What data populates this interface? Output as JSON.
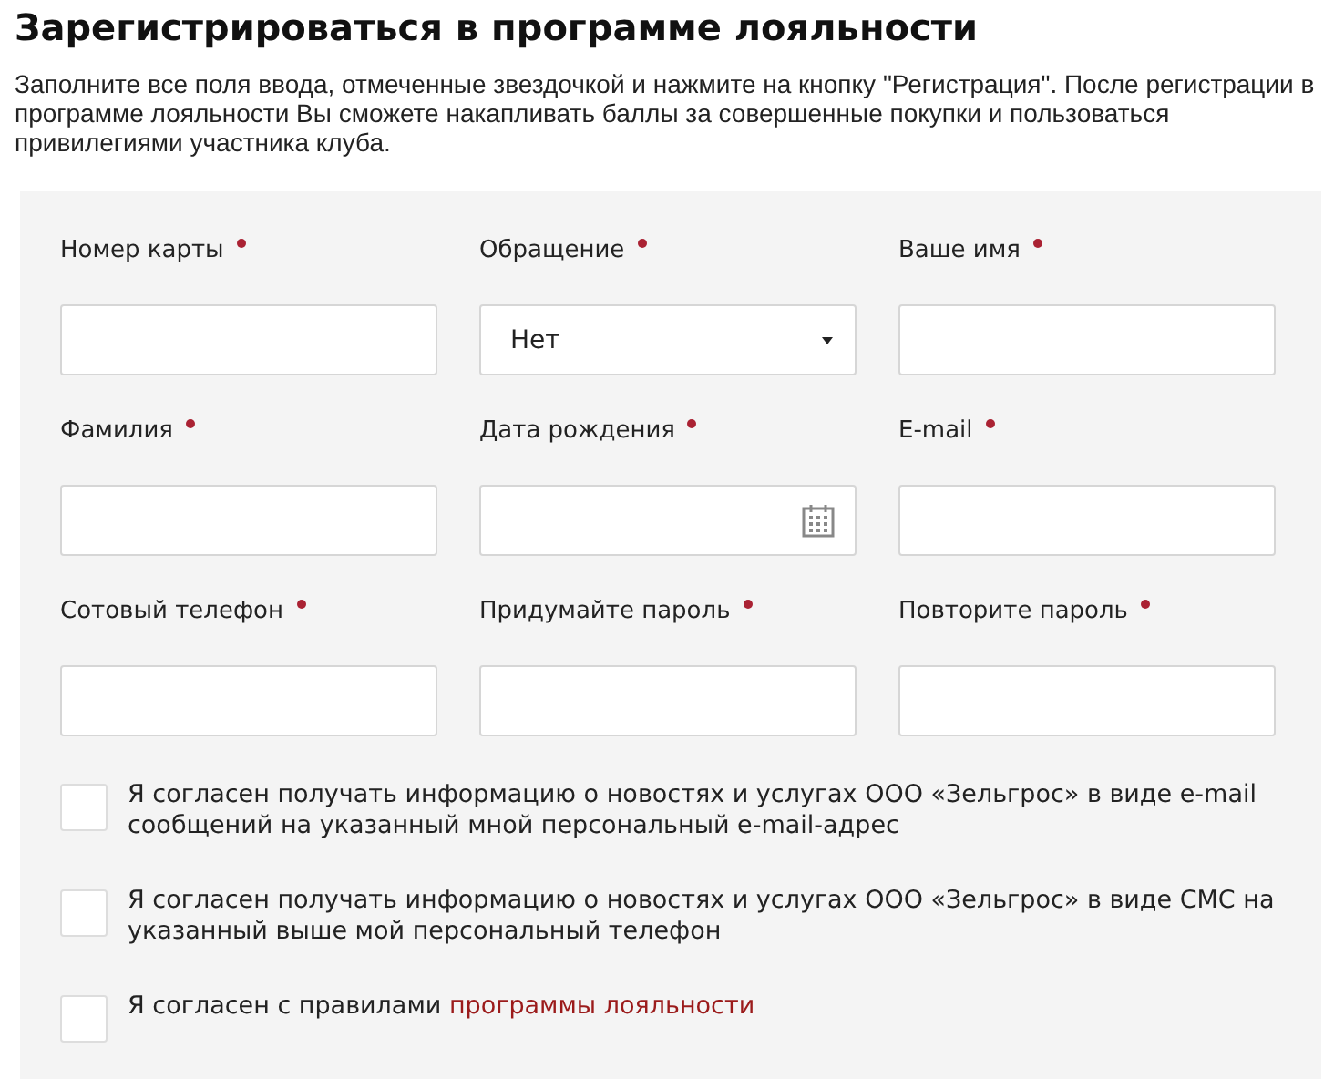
{
  "title": "Зарегистрироваться в программе лояльности",
  "intro": "Заполните все поля ввода, отмеченные звездочкой и нажмите на кнопку \"Регистрация\". После регистрации в программе лояльности Вы сможете накапливать баллы за совершенные покупки и пользоваться привилегиями участника клуба.",
  "fields": [
    {
      "label": "Номер карты",
      "required": true,
      "kind": "text"
    },
    {
      "label": "Обращение",
      "required": true,
      "kind": "select",
      "value": "Нет"
    },
    {
      "label": "Ваше имя",
      "required": true,
      "kind": "text"
    },
    {
      "label": "Фамилия",
      "required": true,
      "kind": "text"
    },
    {
      "label": "Дата рождения",
      "required": true,
      "kind": "date"
    },
    {
      "label": "E-mail",
      "required": true,
      "kind": "text"
    },
    {
      "label": "Сотовый телефон",
      "required": true,
      "kind": "text"
    },
    {
      "label": "Придумайте пароль",
      "required": true,
      "kind": "text"
    },
    {
      "label": "Повторите пароль",
      "required": true,
      "kind": "text"
    }
  ],
  "consents": [
    {
      "text": "Я согласен получать информацию о новостях и услугах ООО «Зельгрос» в виде e-mail сообщений на указанный мной персональный e-mail-адрес",
      "checked": false
    },
    {
      "text": "Я согласен получать информацию о новостях и услугах ООО «Зельгрос» в виде СМС на указанный выше мой персональный телефон",
      "checked": false
    },
    {
      "text": "Я согласен с правилами",
      "link": "программы лояльности",
      "checked": false
    }
  ]
}
